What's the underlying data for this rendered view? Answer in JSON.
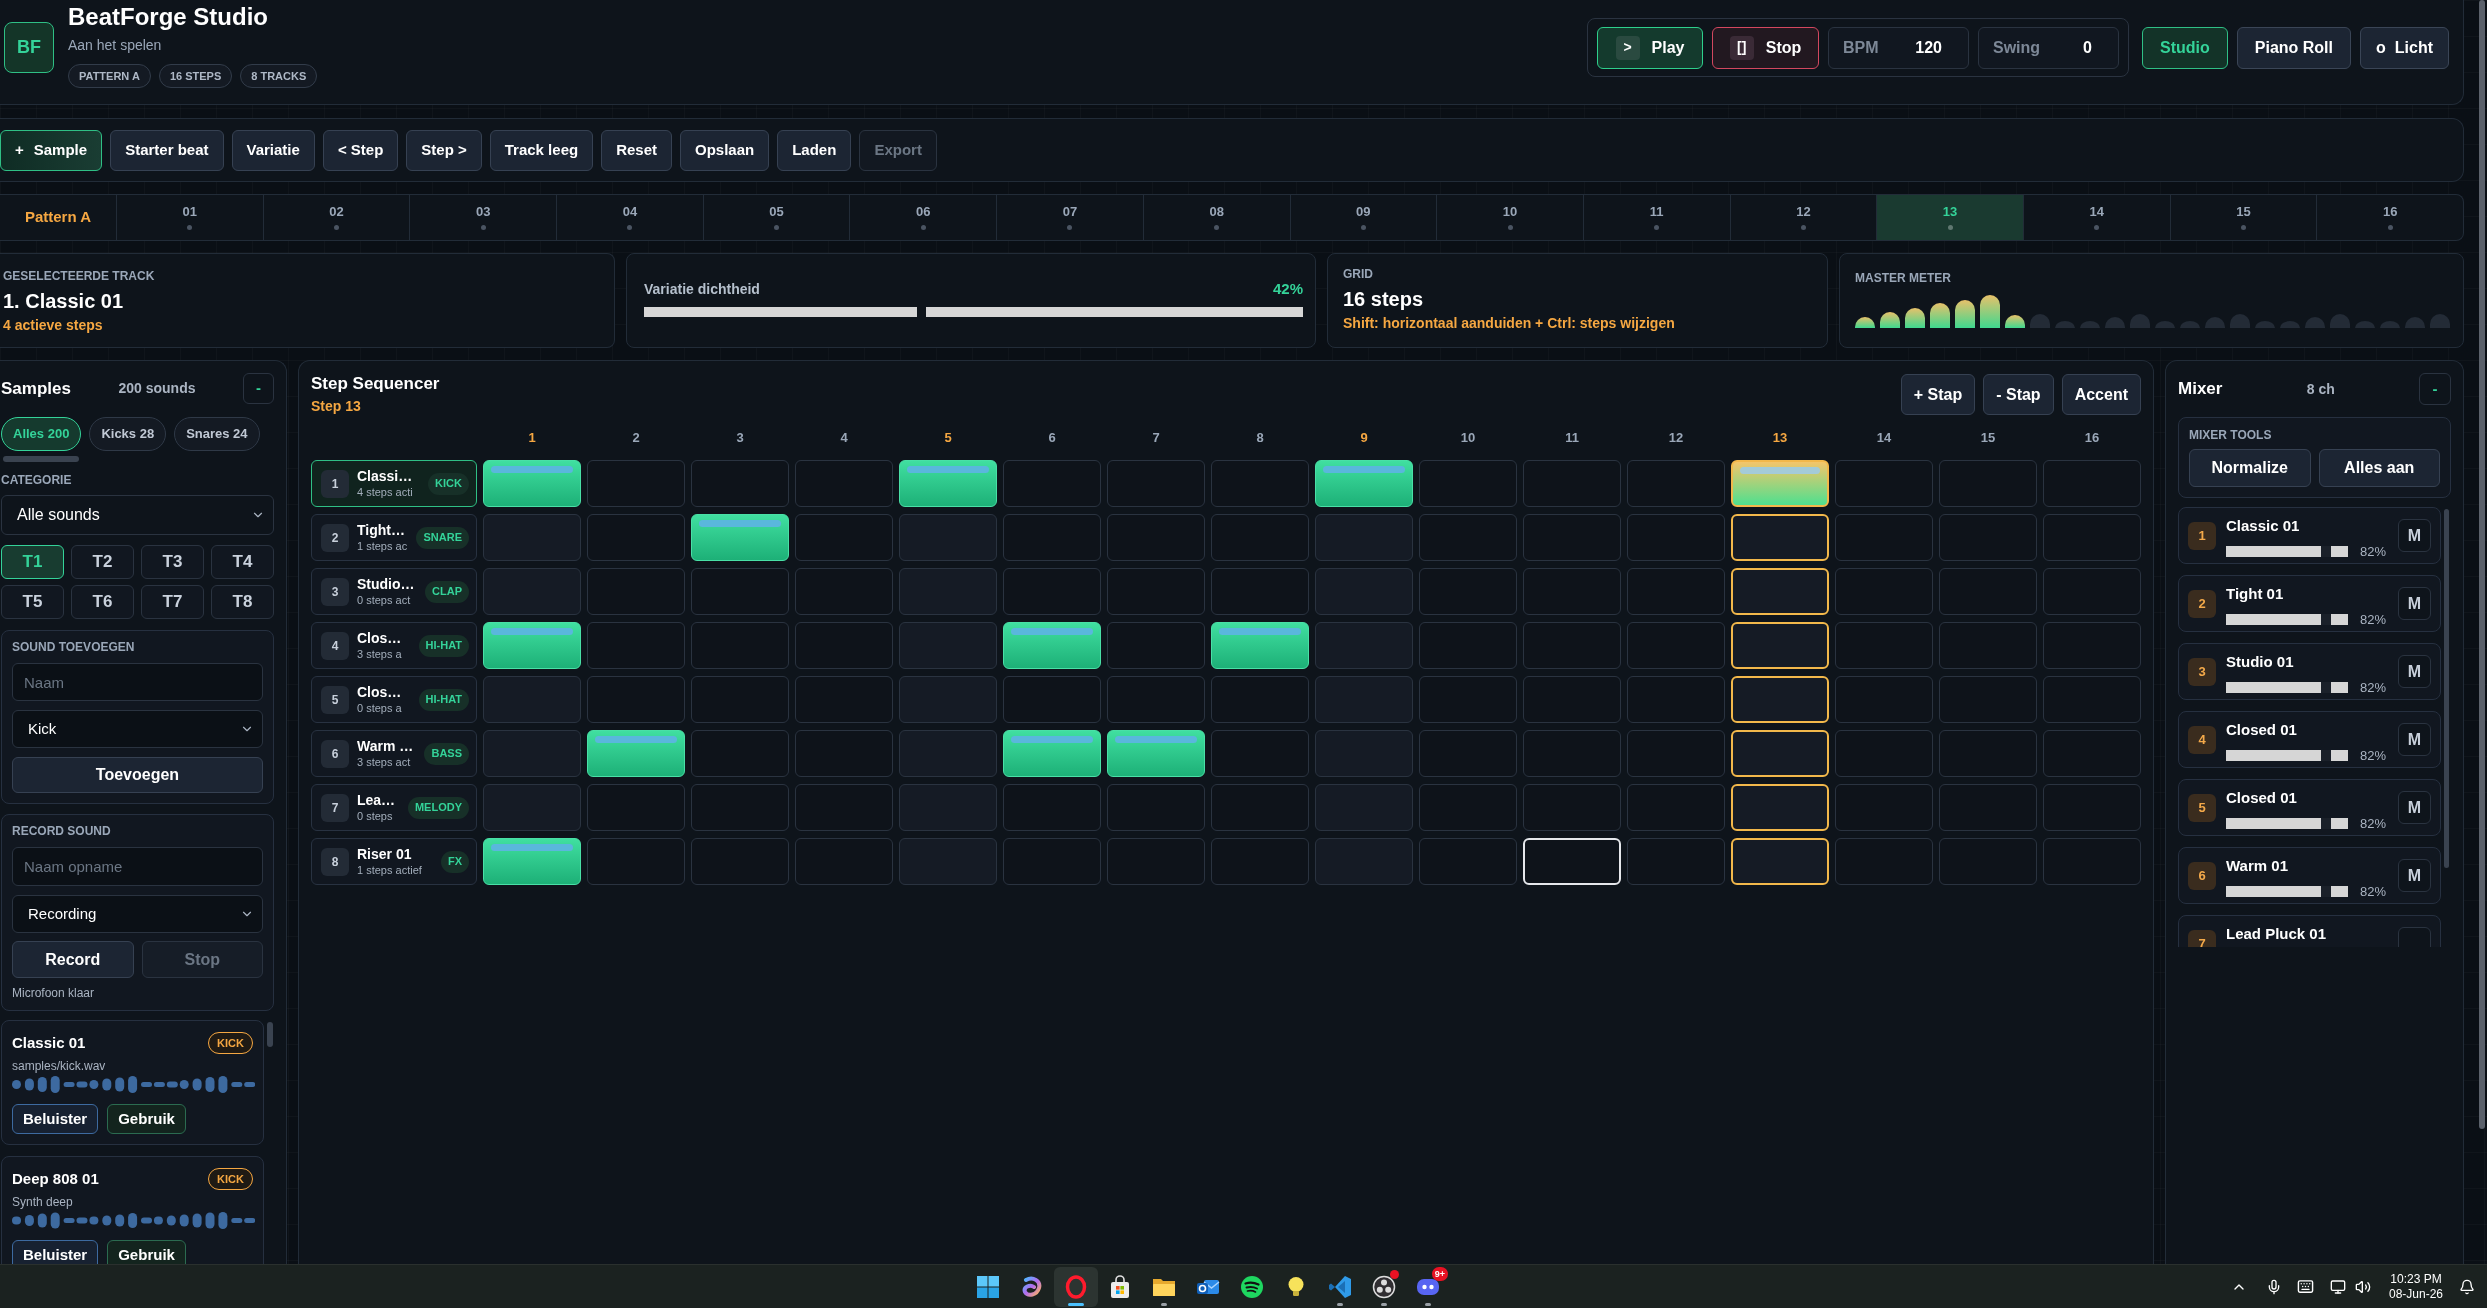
{
  "header": {
    "logo": "BF",
    "title": "BeatForge Studio",
    "status": "Aan het spelen",
    "tags": [
      "PATTERN A",
      "16 STEPS",
      "8 TRACKS"
    ],
    "play_button": {
      "icon": ">",
      "label": "Play"
    },
    "stop_button": {
      "icon": "[]",
      "label": "Stop"
    },
    "fields": [
      {
        "label": "BPM",
        "value": "120"
      },
      {
        "label": "Swing",
        "value": "0"
      }
    ],
    "views": [
      {
        "label": "Studio",
        "selected": true
      },
      {
        "label": "Piano Roll",
        "selected": false
      }
    ],
    "theme_button": {
      "icon": "o",
      "label": "Licht"
    }
  },
  "toolbar": [
    {
      "icon": "+",
      "label": "Sample",
      "primary": true,
      "disabled": false
    },
    {
      "label": "Starter beat",
      "primary": false,
      "disabled": false
    },
    {
      "label": "Variatie",
      "primary": false,
      "disabled": false
    },
    {
      "label": "< Step",
      "primary": false,
      "disabled": false
    },
    {
      "label": "Step >",
      "primary": false,
      "disabled": false
    },
    {
      "label": "Track leeg",
      "primary": false,
      "disabled": false
    },
    {
      "label": "Reset",
      "primary": false,
      "disabled": false
    },
    {
      "label": "Opslaan",
      "primary": false,
      "disabled": false
    },
    {
      "label": "Laden",
      "primary": false,
      "disabled": false
    },
    {
      "label": "Export",
      "primary": false,
      "disabled": true
    }
  ],
  "step_bar": {
    "pattern": "Pattern A",
    "steps": [
      {
        "label": "01",
        "current": false
      },
      {
        "label": "02",
        "current": false
      },
      {
        "label": "03",
        "current": false
      },
      {
        "label": "04",
        "current": false
      },
      {
        "label": "05",
        "current": false
      },
      {
        "label": "06",
        "current": false
      },
      {
        "label": "07",
        "current": false
      },
      {
        "label": "08",
        "current": false
      },
      {
        "label": "09",
        "current": false
      },
      {
        "label": "10",
        "current": false
      },
      {
        "label": "11",
        "current": false
      },
      {
        "label": "12",
        "current": false
      },
      {
        "label": "13",
        "current": true
      },
      {
        "label": "14",
        "current": false
      },
      {
        "label": "15",
        "current": false
      },
      {
        "label": "16",
        "current": false
      }
    ]
  },
  "info": {
    "selected_track": {
      "caption": "GESELECTEERDE TRACK",
      "name": "1. Classic 01",
      "detail": "4 actieve steps"
    },
    "variation": {
      "label": "Variatie dichtheid",
      "reading": "42%",
      "level": 0.42
    },
    "grid": {
      "caption": "GRID",
      "value": "16 steps",
      "hint": "Shift: horizontaal aanduiden + Ctrl: steps wijzigen"
    },
    "master_meter": {
      "caption": "MASTER METER",
      "level": 0.29
    }
  },
  "samples": {
    "title": "Samples",
    "count": "200 sounds",
    "collapse": "-",
    "filters": [
      {
        "label": "Alles 200",
        "selected": true
      },
      {
        "label": "Kicks 28",
        "selected": false
      },
      {
        "label": "Snares 24",
        "selected": false
      }
    ],
    "category": {
      "caption": "CATEGORIE",
      "value": "Alle sounds"
    },
    "track_buttons": [
      {
        "label": "T1",
        "selected": true
      },
      {
        "label": "T2",
        "selected": false
      },
      {
        "label": "T3",
        "selected": false
      },
      {
        "label": "T4",
        "selected": false
      },
      {
        "label": "T5",
        "selected": false
      },
      {
        "label": "T6",
        "selected": false
      },
      {
        "label": "T7",
        "selected": false
      },
      {
        "label": "T8",
        "selected": false
      }
    ],
    "add_sound": {
      "caption": "SOUND TOEVOEGEN",
      "name_field": {
        "placeholder": "Naam"
      },
      "type_select": {
        "value": "Kick"
      },
      "button": "Toevoegen"
    },
    "record": {
      "caption": "RECORD SOUND",
      "name_field": {
        "placeholder": "Naam opname"
      },
      "source_select": {
        "value": "Recording"
      },
      "record_button": {
        "label": "Record",
        "disabled": false
      },
      "stop_button": {
        "label": "Stop",
        "disabled": true
      },
      "status": "Microfoon klaar"
    },
    "library": [
      {
        "name": "Classic 01",
        "tag": "KICK",
        "detail": "samples/kick.wav",
        "actions": [
          "Beluister",
          "Gebruik"
        ]
      },
      {
        "name": "Deep 808 01",
        "tag": "KICK",
        "detail": "Synth deep",
        "actions": [
          "Beluister",
          "Gebruik"
        ]
      }
    ]
  },
  "sequencer": {
    "title": "Step Sequencer",
    "current": "Step 13",
    "buttons": [
      "+ Stap",
      "- Stap",
      "Accent"
    ],
    "columns": [
      {
        "label": "1",
        "downbeat": true,
        "current": false
      },
      {
        "label": "2",
        "downbeat": false,
        "current": false
      },
      {
        "label": "3",
        "downbeat": false,
        "current": false
      },
      {
        "label": "4",
        "downbeat": false,
        "current": false
      },
      {
        "label": "5",
        "downbeat": true,
        "current": false
      },
      {
        "label": "6",
        "downbeat": false,
        "current": false
      },
      {
        "label": "7",
        "downbeat": false,
        "current": false
      },
      {
        "label": "8",
        "downbeat": false,
        "current": false
      },
      {
        "label": "9",
        "downbeat": true,
        "current": false
      },
      {
        "label": "10",
        "downbeat": false,
        "current": false
      },
      {
        "label": "11",
        "downbeat": false,
        "current": false
      },
      {
        "label": "12",
        "downbeat": false,
        "current": false
      },
      {
        "label": "13",
        "downbeat": true,
        "current": true
      },
      {
        "label": "14",
        "downbeat": false,
        "current": false
      },
      {
        "label": "15",
        "downbeat": false,
        "current": false
      },
      {
        "label": "16",
        "downbeat": false,
        "current": false
      }
    ],
    "tracks": [
      {
        "number": "1",
        "name": "Classi…",
        "detail": "4 steps acti",
        "tag": "KICK",
        "selected": true,
        "steps": [
          {
            "on": true,
            "focused": false
          },
          {
            "on": false,
            "focused": false
          },
          {
            "on": false,
            "focused": false
          },
          {
            "on": false,
            "focused": false
          },
          {
            "on": true,
            "focused": false
          },
          {
            "on": false,
            "focused": false
          },
          {
            "on": false,
            "focused": false
          },
          {
            "on": false,
            "focused": false
          },
          {
            "on": true,
            "focused": false
          },
          {
            "on": false,
            "focused": false
          },
          {
            "on": false,
            "focused": false
          },
          {
            "on": false,
            "focused": false
          },
          {
            "on": true,
            "focused": false
          },
          {
            "on": false,
            "focused": false
          },
          {
            "on": false,
            "focused": false
          },
          {
            "on": false,
            "focused": false
          }
        ]
      },
      {
        "number": "2",
        "name": "Tight…",
        "detail": "1 steps ac",
        "tag": "SNARE",
        "selected": false,
        "steps": [
          {
            "on": false,
            "focused": false
          },
          {
            "on": false,
            "focused": false
          },
          {
            "on": true,
            "focused": false
          },
          {
            "on": false,
            "focused": false
          },
          {
            "on": false,
            "focused": false
          },
          {
            "on": false,
            "focused": false
          },
          {
            "on": false,
            "focused": false
          },
          {
            "on": false,
            "focused": false
          },
          {
            "on": false,
            "focused": false
          },
          {
            "on": false,
            "focused": false
          },
          {
            "on": false,
            "focused": false
          },
          {
            "on": false,
            "focused": false
          },
          {
            "on": false,
            "focused": false
          },
          {
            "on": false,
            "focused": false
          },
          {
            "on": false,
            "focused": false
          },
          {
            "on": false,
            "focused": false
          }
        ]
      },
      {
        "number": "3",
        "name": "Studio…",
        "detail": "0 steps act",
        "tag": "CLAP",
        "selected": false,
        "steps": [
          {
            "on": false,
            "focused": false
          },
          {
            "on": false,
            "focused": false
          },
          {
            "on": false,
            "focused": false
          },
          {
            "on": false,
            "focused": false
          },
          {
            "on": false,
            "focused": false
          },
          {
            "on": false,
            "focused": false
          },
          {
            "on": false,
            "focused": false
          },
          {
            "on": false,
            "focused": false
          },
          {
            "on": false,
            "focused": false
          },
          {
            "on": false,
            "focused": false
          },
          {
            "on": false,
            "focused": false
          },
          {
            "on": false,
            "focused": false
          },
          {
            "on": false,
            "focused": false
          },
          {
            "on": false,
            "focused": false
          },
          {
            "on": false,
            "focused": false
          },
          {
            "on": false,
            "focused": false
          }
        ]
      },
      {
        "number": "4",
        "name": "Clos…",
        "detail": "3 steps a",
        "tag": "HI-HAT",
        "selected": false,
        "steps": [
          {
            "on": true,
            "focused": false
          },
          {
            "on": false,
            "focused": false
          },
          {
            "on": false,
            "focused": false
          },
          {
            "on": false,
            "focused": false
          },
          {
            "on": false,
            "focused": false
          },
          {
            "on": true,
            "focused": false
          },
          {
            "on": false,
            "focused": false
          },
          {
            "on": true,
            "focused": false
          },
          {
            "on": false,
            "focused": false
          },
          {
            "on": false,
            "focused": false
          },
          {
            "on": false,
            "focused": false
          },
          {
            "on": false,
            "focused": false
          },
          {
            "on": false,
            "focused": false
          },
          {
            "on": false,
            "focused": false
          },
          {
            "on": false,
            "focused": false
          },
          {
            "on": false,
            "focused": false
          }
        ]
      },
      {
        "number": "5",
        "name": "Clos…",
        "detail": "0 steps a",
        "tag": "HI-HAT",
        "selected": false,
        "steps": [
          {
            "on": false,
            "focused": false
          },
          {
            "on": false,
            "focused": false
          },
          {
            "on": false,
            "focused": false
          },
          {
            "on": false,
            "focused": false
          },
          {
            "on": false,
            "focused": false
          },
          {
            "on": false,
            "focused": false
          },
          {
            "on": false,
            "focused": false
          },
          {
            "on": false,
            "focused": false
          },
          {
            "on": false,
            "focused": false
          },
          {
            "on": false,
            "focused": false
          },
          {
            "on": false,
            "focused": false
          },
          {
            "on": false,
            "focused": false
          },
          {
            "on": false,
            "focused": false
          },
          {
            "on": false,
            "focused": false
          },
          {
            "on": false,
            "focused": false
          },
          {
            "on": false,
            "focused": false
          }
        ]
      },
      {
        "number": "6",
        "name": "Warm …",
        "detail": "3 steps act",
        "tag": "BASS",
        "selected": false,
        "steps": [
          {
            "on": false,
            "focused": false
          },
          {
            "on": true,
            "focused": false
          },
          {
            "on": false,
            "focused": false
          },
          {
            "on": false,
            "focused": false
          },
          {
            "on": false,
            "focused": false
          },
          {
            "on": true,
            "focused": false
          },
          {
            "on": true,
            "focused": false
          },
          {
            "on": false,
            "focused": false
          },
          {
            "on": false,
            "focused": false
          },
          {
            "on": false,
            "focused": false
          },
          {
            "on": false,
            "focused": false
          },
          {
            "on": false,
            "focused": false
          },
          {
            "on": false,
            "focused": false
          },
          {
            "on": false,
            "focused": false
          },
          {
            "on": false,
            "focused": false
          },
          {
            "on": false,
            "focused": false
          }
        ]
      },
      {
        "number": "7",
        "name": "Lea…",
        "detail": "0 steps",
        "tag": "MELODY",
        "selected": false,
        "steps": [
          {
            "on": false,
            "focused": false
          },
          {
            "on": false,
            "focused": false
          },
          {
            "on": false,
            "focused": false
          },
          {
            "on": false,
            "focused": false
          },
          {
            "on": false,
            "focused": false
          },
          {
            "on": false,
            "focused": false
          },
          {
            "on": false,
            "focused": false
          },
          {
            "on": false,
            "focused": false
          },
          {
            "on": false,
            "focused": false
          },
          {
            "on": false,
            "focused": false
          },
          {
            "on": false,
            "focused": false
          },
          {
            "on": false,
            "focused": false
          },
          {
            "on": false,
            "focused": false
          },
          {
            "on": false,
            "focused": false
          },
          {
            "on": false,
            "focused": false
          },
          {
            "on": false,
            "focused": false
          }
        ]
      },
      {
        "number": "8",
        "name": "Riser 01",
        "detail": "1 steps actief",
        "tag": "FX",
        "selected": false,
        "steps": [
          {
            "on": true,
            "focused": false
          },
          {
            "on": false,
            "focused": false
          },
          {
            "on": false,
            "focused": false
          },
          {
            "on": false,
            "focused": false
          },
          {
            "on": false,
            "focused": false
          },
          {
            "on": false,
            "focused": false
          },
          {
            "on": false,
            "focused": false
          },
          {
            "on": false,
            "focused": false
          },
          {
            "on": false,
            "focused": false
          },
          {
            "on": false,
            "focused": false
          },
          {
            "on": false,
            "focused": true
          },
          {
            "on": false,
            "focused": false
          },
          {
            "on": false,
            "focused": false
          },
          {
            "on": false,
            "focused": false
          },
          {
            "on": false,
            "focused": false
          },
          {
            "on": false,
            "focused": false
          }
        ]
      }
    ]
  },
  "mixer": {
    "title": "Mixer",
    "count": "8 ch",
    "collapse": "-",
    "tools": {
      "caption": "MIXER TOOLS",
      "buttons": [
        "Normalize",
        "Alles aan"
      ]
    },
    "channels": [
      {
        "number": "1",
        "name": "Classic 01",
        "level": 0.82,
        "reading": "82%",
        "mute": "M",
        "muted": false
      },
      {
        "number": "2",
        "name": "Tight 01",
        "level": 0.82,
        "reading": "82%",
        "mute": "M",
        "muted": false
      },
      {
        "number": "3",
        "name": "Studio 01",
        "level": 0.82,
        "reading": "82%",
        "mute": "M",
        "muted": false
      },
      {
        "number": "4",
        "name": "Closed 01",
        "level": 0.82,
        "reading": "82%",
        "mute": "M",
        "muted": false
      },
      {
        "number": "5",
        "name": "Closed 01",
        "level": 0.82,
        "reading": "82%",
        "mute": "M",
        "muted": false
      },
      {
        "number": "6",
        "name": "Warm 01",
        "level": 0.82,
        "reading": "82%",
        "mute": "M",
        "muted": false
      },
      {
        "number": "7",
        "name": "Lead Pluck 01",
        "muted": false
      }
    ]
  },
  "taskbar": {
    "apps": [
      {
        "kind": "start",
        "running": false,
        "active": false,
        "alert": false
      },
      {
        "kind": "assistant",
        "running": false,
        "active": false,
        "alert": false
      },
      {
        "kind": "browser",
        "running": true,
        "active": true,
        "alert": false
      },
      {
        "kind": "store",
        "running": false,
        "active": false,
        "alert": false
      },
      {
        "kind": "files",
        "running": true,
        "active": false,
        "alert": false
      },
      {
        "kind": "mail",
        "running": false,
        "active": false,
        "alert": false
      },
      {
        "kind": "music",
        "running": false,
        "active": false,
        "alert": false
      },
      {
        "kind": "notes",
        "running": false,
        "active": false,
        "alert": false
      },
      {
        "kind": "editor",
        "running": true,
        "active": false,
        "alert": false
      },
      {
        "kind": "recorder",
        "running": true,
        "active": false,
        "alert": true
      },
      {
        "kind": "chat",
        "running": true,
        "active": false,
        "alert": false,
        "badge": "9+"
      }
    ],
    "clock": {
      "time": "10:23 PM",
      "date": "08-Jun-26"
    }
  }
}
